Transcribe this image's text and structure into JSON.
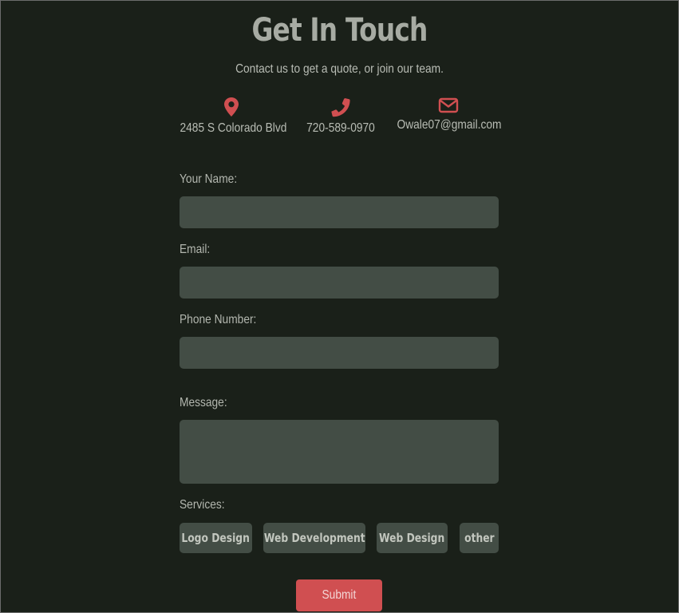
{
  "header": {
    "title": "Get In Touch",
    "subtitle": "Contact us to get a quote, or join our team."
  },
  "contacts": [
    {
      "icon": "map-marker-icon",
      "text": "2485 S Colorado Blvd"
    },
    {
      "icon": "phone-icon",
      "text": "720-589-0970"
    },
    {
      "icon": "envelope-icon",
      "text": "Owale07@gmail.com"
    }
  ],
  "form": {
    "name_label": "Your Name:",
    "name_value": "",
    "email_label": "Email:",
    "email_value": "",
    "phone_label": "Phone Number:",
    "phone_value": "",
    "message_label": "Message:",
    "message_value": "",
    "services_label": "Services:",
    "services": [
      "Logo Design",
      "Web Development",
      "Web Design",
      "other"
    ],
    "submit_label": "Submit"
  },
  "colors": {
    "background": "#1a2019",
    "field": "#434d45",
    "accent": "#d04f51",
    "title": "#a7aba3"
  }
}
